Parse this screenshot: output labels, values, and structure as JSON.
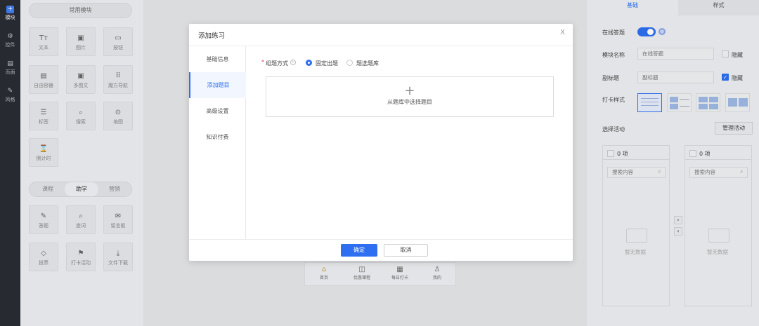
{
  "nav": {
    "items": [
      {
        "label": "模块",
        "icon": "plus-square-icon"
      },
      {
        "label": "控件",
        "icon": "sliders-icon"
      },
      {
        "label": "页面",
        "icon": "pages-icon"
      },
      {
        "label": "风格",
        "icon": "magic-wand-icon"
      }
    ]
  },
  "library": {
    "header": "常用模块",
    "common": [
      {
        "label": "文本",
        "glyph": "Tт"
      },
      {
        "label": "图片",
        "glyph": "▣"
      },
      {
        "label": "按钮",
        "glyph": "▭"
      },
      {
        "label": "自由容器",
        "glyph": "▤"
      },
      {
        "label": "多图文",
        "glyph": "▣"
      },
      {
        "label": "魔方导航",
        "glyph": "⠿"
      },
      {
        "label": "标签",
        "glyph": "☰"
      },
      {
        "label": "搜索",
        "glyph": "⌕"
      },
      {
        "label": "地图",
        "glyph": "⊙"
      },
      {
        "label": "倒计时",
        "glyph": "⌛"
      }
    ],
    "tabs": [
      "课程",
      "助学",
      "营销"
    ],
    "active_tab": "助学",
    "study": [
      {
        "label": "答题",
        "glyph": "✎"
      },
      {
        "label": "查词",
        "glyph": "⌕"
      },
      {
        "label": "留言板",
        "glyph": "✉"
      },
      {
        "label": "投票",
        "glyph": "◇"
      },
      {
        "label": "打卡活动",
        "glyph": "⚑"
      },
      {
        "label": "文件下载",
        "glyph": "⤓"
      }
    ]
  },
  "phone_tabbar": [
    {
      "label": "首页",
      "glyph": "⌂",
      "active": true
    },
    {
      "label": "优惠课程",
      "glyph": "◫",
      "active": false
    },
    {
      "label": "每日打卡",
      "glyph": "▦",
      "active": false
    },
    {
      "label": "我的",
      "glyph": "♙",
      "active": false
    }
  ],
  "settings": {
    "tabs": [
      "基础",
      "样式"
    ],
    "active_tab": "基础",
    "online_label": "在线答题",
    "module_name_label": "模块名称",
    "module_name_value": "在线答题",
    "hide_label": "隐藏",
    "subtitle_label": "副标题",
    "subtitle_value": "副标题",
    "subtitle_hide_label": "隐藏",
    "checkin_style_label": "打卡样式",
    "select_activity_label": "选择活动",
    "manage_button": "管理活动",
    "left_count": "0 项",
    "right_count": "0 项",
    "search_placeholder": "搜索内容",
    "empty_text": "暂无数据",
    "arrow_right": "›",
    "arrow_left": "‹"
  },
  "modal": {
    "title": "添加练习",
    "close": "X",
    "sidebar": [
      "基础信息",
      "添加题目",
      "高级设置",
      "知识付费"
    ],
    "active_sidebar": "添加题目",
    "required_mark": "*",
    "question_mode_label": "组题方式",
    "info_mark": "i",
    "options": [
      "固定出题",
      "题选题库"
    ],
    "selected_option": "固定出题",
    "dropzone_plus": "+",
    "dropzone_text": "从题库中选择题目",
    "ok": "确定",
    "cancel": "取消"
  },
  "colors": {
    "primary": "#2d6ff0",
    "nav_bg": "#2a2c33"
  }
}
